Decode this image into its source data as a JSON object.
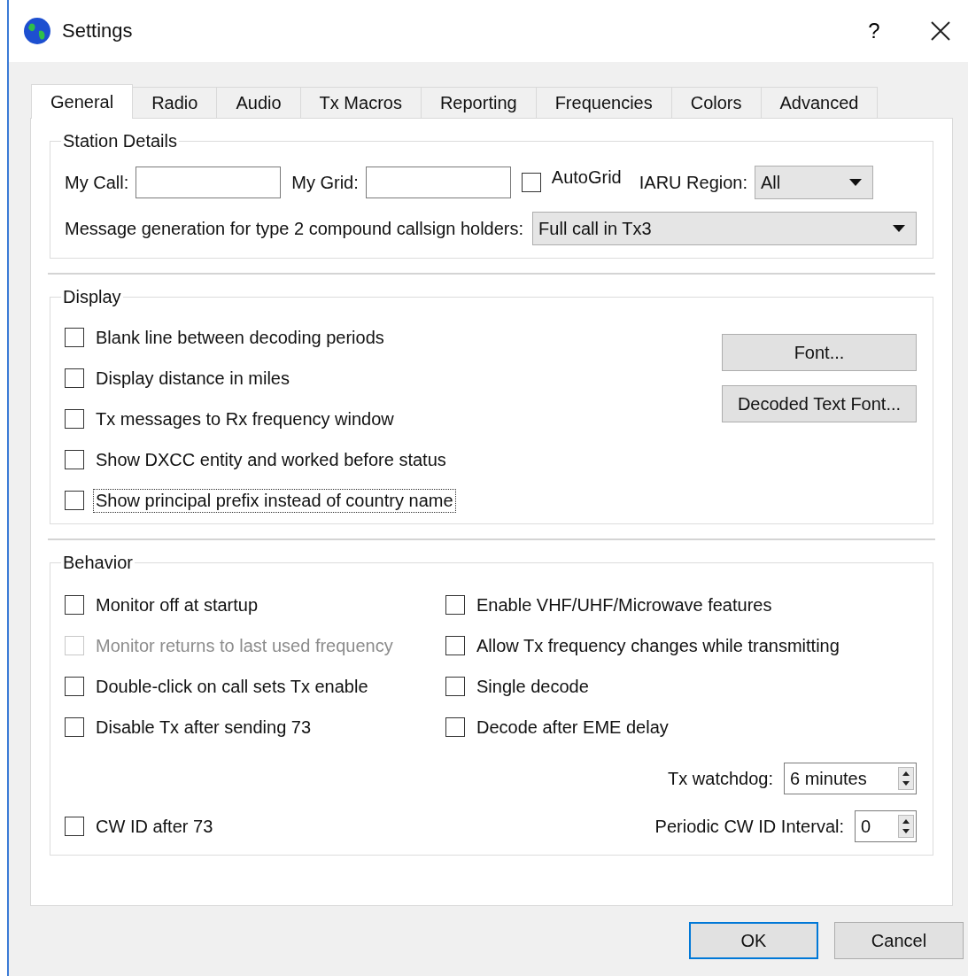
{
  "window": {
    "title": "Settings",
    "help_label": "?"
  },
  "tabs": [
    {
      "label": "General",
      "selected": true
    },
    {
      "label": "Radio",
      "selected": false
    },
    {
      "label": "Audio",
      "selected": false
    },
    {
      "label": "Tx Macros",
      "selected": false
    },
    {
      "label": "Reporting",
      "selected": false
    },
    {
      "label": "Frequencies",
      "selected": false
    },
    {
      "label": "Colors",
      "selected": false
    },
    {
      "label": "Advanced",
      "selected": false
    }
  ],
  "station_details": {
    "title": "Station Details",
    "my_call_label": "My Call:",
    "my_grid_label": "My Grid:",
    "autogrid": {
      "label": "AutoGrid",
      "checked": false
    },
    "iaru_region": {
      "label": "IARU Region:",
      "value": "All"
    },
    "message_generation": {
      "label": "Message generation for type 2 compound callsign holders:",
      "value": "Full call in Tx3"
    }
  },
  "display": {
    "title": "Display",
    "options": [
      {
        "label": "Blank line between decoding periods",
        "checked": false,
        "focused": false
      },
      {
        "label": "Display distance in miles",
        "checked": false,
        "focused": false
      },
      {
        "label": "Tx messages to Rx frequency window",
        "checked": false,
        "focused": false
      },
      {
        "label": "Show DXCC entity and worked before status",
        "checked": false,
        "focused": false
      },
      {
        "label": "Show principal prefix instead of country name",
        "checked": false,
        "focused": true
      }
    ],
    "buttons": [
      "Font...",
      "Decoded Text Font..."
    ]
  },
  "behavior": {
    "title": "Behavior",
    "left_options": [
      {
        "label": "Monitor off at startup",
        "checked": false,
        "disabled": false
      },
      {
        "label": "Monitor returns to last used frequency",
        "checked": false,
        "disabled": true
      },
      {
        "label": "Double-click on call sets Tx enable",
        "checked": false,
        "disabled": false
      },
      {
        "label": "Disable Tx after sending 73",
        "checked": false,
        "disabled": false
      }
    ],
    "right_options": [
      {
        "label": "Enable VHF/UHF/Microwave features",
        "checked": false,
        "disabled": false
      },
      {
        "label": "Allow Tx frequency changes while transmitting",
        "checked": false,
        "disabled": false
      },
      {
        "label": "Single decode",
        "checked": false,
        "disabled": false
      },
      {
        "label": "Decode after EME delay",
        "checked": false,
        "disabled": false
      }
    ],
    "tx_watchdog": {
      "label": "Tx watchdog:",
      "value": "6 minutes"
    },
    "cw_id": {
      "label": "CW ID after 73",
      "checked": false
    },
    "cw_interval": {
      "label": "Periodic CW ID Interval:",
      "value": "0"
    }
  },
  "buttons": [
    {
      "label": "OK",
      "default": true
    },
    {
      "label": "Cancel",
      "default": false
    }
  ]
}
